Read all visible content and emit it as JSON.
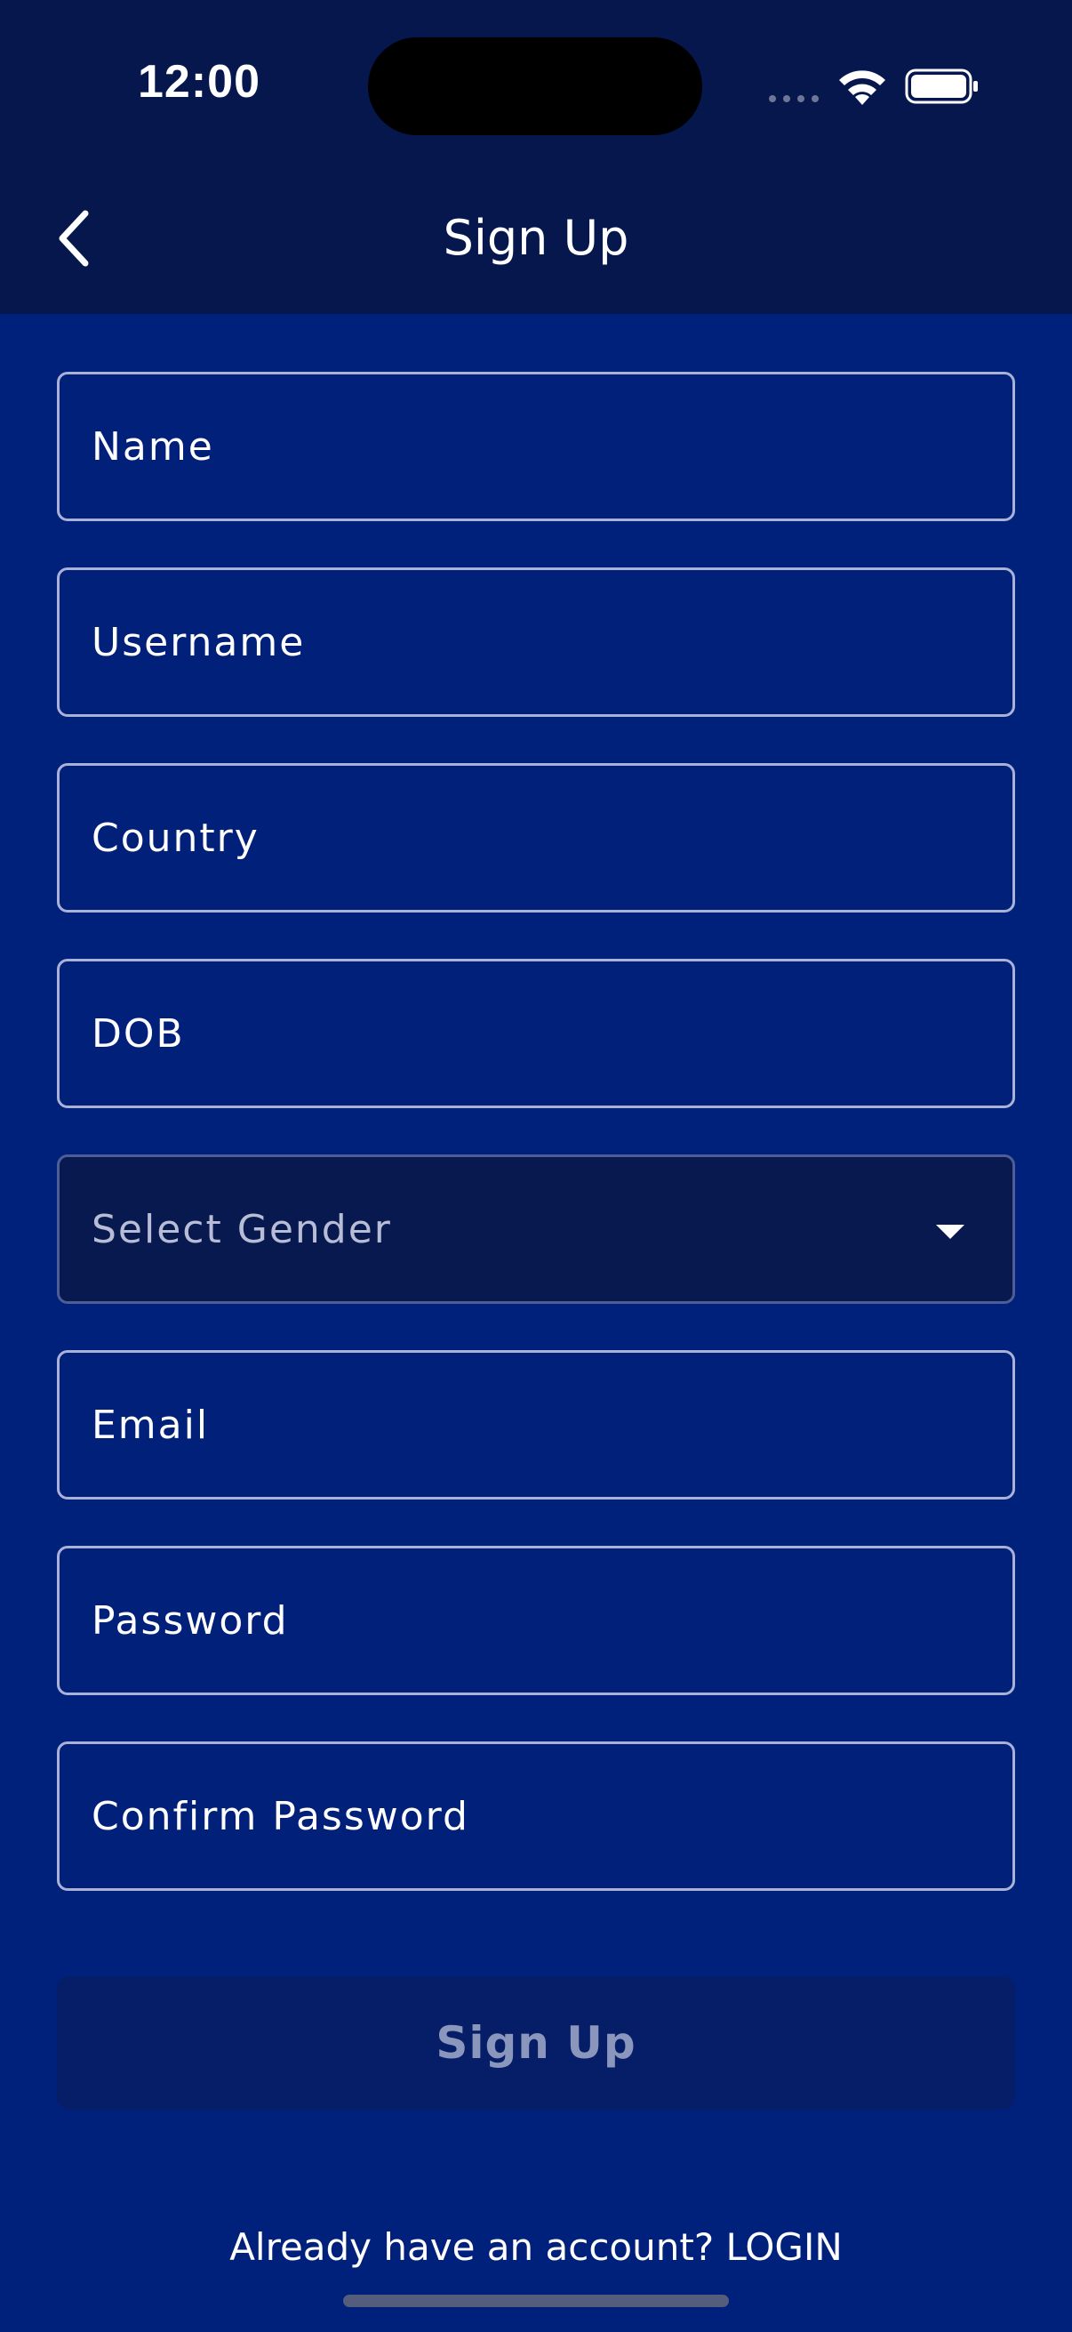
{
  "status_bar": {
    "time": "12:00"
  },
  "header": {
    "title": "Sign Up",
    "back_icon": "chevron-left-icon"
  },
  "form": {
    "name_placeholder": "Name",
    "username_placeholder": "Username",
    "country_placeholder": "Country",
    "dob_placeholder": "DOB",
    "gender_select_label": "Select Gender",
    "email_placeholder": "Email",
    "password_placeholder": "Password",
    "confirm_password_placeholder": "Confirm Password"
  },
  "actions": {
    "signup_label": "Sign Up",
    "login_prompt": "Already have an account? ",
    "login_link": "LOGIN"
  },
  "colors": {
    "background": "#00217b",
    "header_background": "#05174d",
    "field_border": "#a9b1d6",
    "button_background": "#061d67",
    "button_text": "#8b96bd"
  }
}
